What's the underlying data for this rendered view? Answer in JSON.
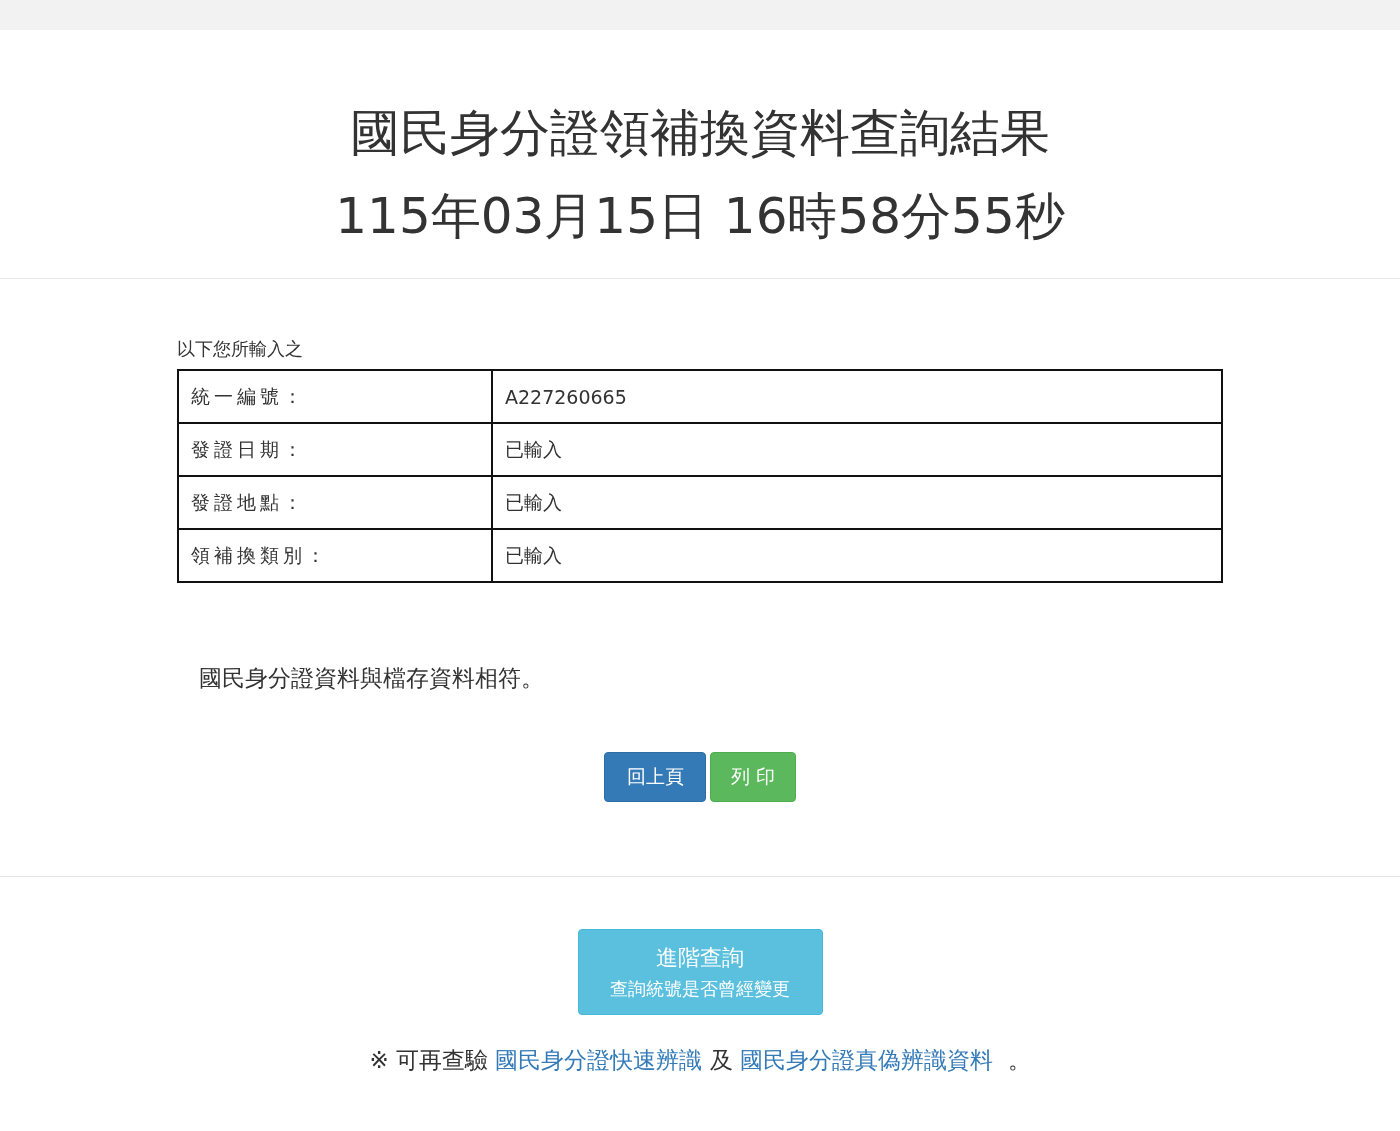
{
  "title": {
    "line1": "國民身分證領補換資料查詢結果",
    "line2": "115年03月15日 16時58分55秒"
  },
  "caption": "以下您所輸入之",
  "table": {
    "rows": [
      {
        "label": "統一編號：",
        "value": "A227260665"
      },
      {
        "label": "發證日期：",
        "value": "已輸入"
      },
      {
        "label": "發證地點：",
        "value": "已輸入"
      },
      {
        "label": "領補換類別：",
        "value": "已輸入"
      }
    ]
  },
  "result_message": "國民身分證資料與檔存資料相符。",
  "buttons": [
    {
      "label": "回上頁",
      "kind": "primary"
    },
    {
      "label": "列 印",
      "kind": "success"
    }
  ],
  "advanced_button": {
    "line1": "進階查詢",
    "line2": "查詢統號是否曾經變更"
  },
  "footer": {
    "prefix": "※ 可再查驗",
    "link1": "國民身分證快速辨識",
    "middle": "及",
    "link2": "國民身分證真偽辨識資料",
    "suffix": "。"
  }
}
